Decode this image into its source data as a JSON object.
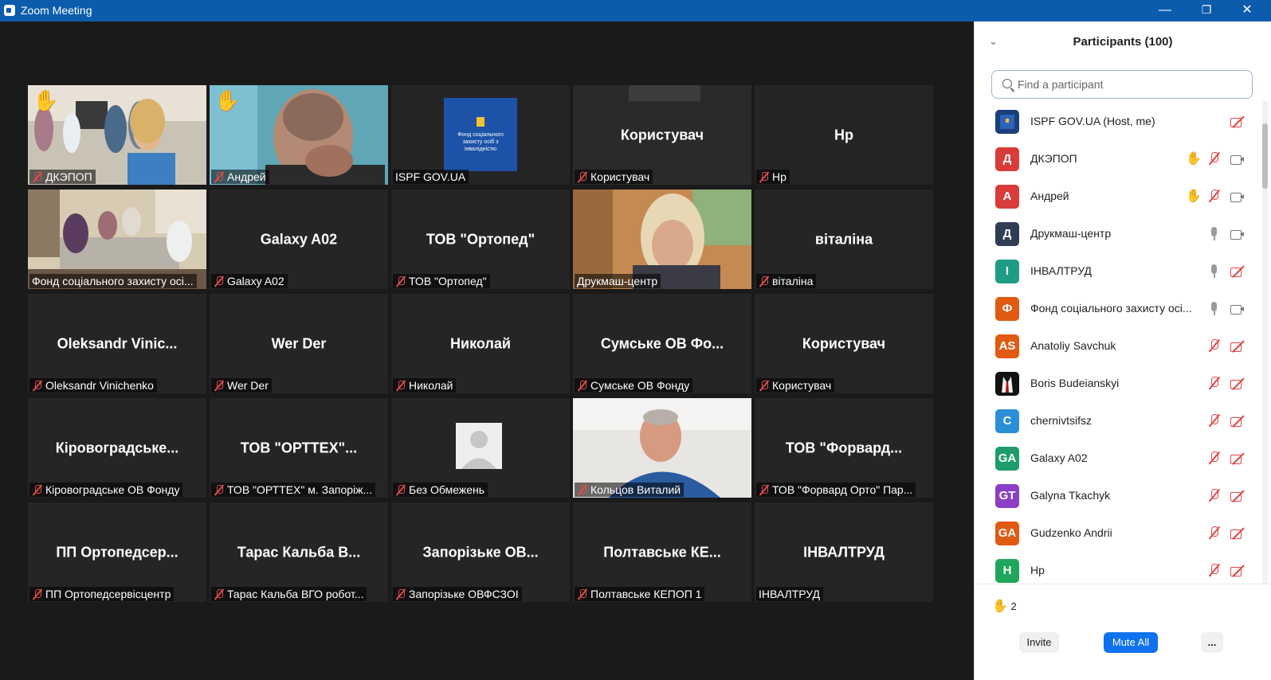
{
  "window": {
    "title": "Zoom Meeting",
    "minimize": "—",
    "restore": "❐",
    "close": "✕"
  },
  "tiles": [
    {
      "label": "ДКЭПОП",
      "center": "",
      "muted": true,
      "hand": true,
      "video": "group-office"
    },
    {
      "label": "Андрей",
      "center": "",
      "muted": true,
      "hand": true,
      "video": "man-closeup"
    },
    {
      "label": "ISPF GOV.UA",
      "center": "",
      "muted": false,
      "hand": false,
      "video": "logo",
      "logo_text": "Фонд соціального захисту осіб з інвалідністю"
    },
    {
      "label": "Користувач",
      "center": "Користувач",
      "muted": true,
      "hand": false,
      "video": "blurred"
    },
    {
      "label": "Нр",
      "center": "Нр",
      "muted": true,
      "hand": false,
      "video": "none"
    },
    {
      "label": "Фонд соціального захисту осі...",
      "center": "",
      "muted": false,
      "hand": false,
      "video": "meeting-room"
    },
    {
      "label": "Galaxy A02",
      "center": "Galaxy A02",
      "muted": true,
      "hand": false,
      "video": "none"
    },
    {
      "label": "ТОВ \"Ортопед\"",
      "center": "ТОВ \"Ортопед\"",
      "muted": true,
      "hand": false,
      "video": "none"
    },
    {
      "label": "Друкмаш-центр",
      "center": "",
      "muted": false,
      "hand": false,
      "video": "woman-office",
      "active": true
    },
    {
      "label": "віталіна",
      "center": "віталіна",
      "muted": true,
      "hand": false,
      "video": "none"
    },
    {
      "label": "Oleksandr Vinichenko",
      "center": "Oleksandr Vinic...",
      "muted": true,
      "hand": false,
      "video": "none"
    },
    {
      "label": "Wer Der",
      "center": "Wer Der",
      "muted": true,
      "hand": false,
      "video": "none"
    },
    {
      "label": "Николай",
      "center": "Николай",
      "muted": true,
      "hand": false,
      "video": "none"
    },
    {
      "label": "Сумське ОВ Фонду",
      "center": "Сумське ОВ Фо...",
      "muted": true,
      "hand": false,
      "video": "none"
    },
    {
      "label": "Користувач",
      "center": "Користувач",
      "muted": true,
      "hand": false,
      "video": "none"
    },
    {
      "label": "Кіровоградське ОВ Фонду",
      "center": "Кіровоградське...",
      "muted": true,
      "hand": false,
      "video": "none"
    },
    {
      "label": "ТОВ \"ОРТТЕХ\" м. Запоріж...",
      "center": "ТОВ \"ОРТТЕХ\"...",
      "muted": true,
      "hand": false,
      "video": "none"
    },
    {
      "label": "Без Обмежень",
      "center": "",
      "muted": true,
      "hand": false,
      "video": "default-avatar"
    },
    {
      "label": "Кольцов Виталий",
      "center": "",
      "muted": true,
      "hand": false,
      "video": "man-office"
    },
    {
      "label": "ТОВ \"Форвард Орто\" Пар...",
      "center": "ТОВ \"Форвард...",
      "muted": true,
      "hand": false,
      "video": "none"
    },
    {
      "label": "ПП Ортопедсервісцентр",
      "center": "ПП Ортопедсер...",
      "muted": true,
      "hand": false,
      "video": "none"
    },
    {
      "label": "Тарас Кальба ВГО робот...",
      "center": "Тарас Кальба В...",
      "muted": true,
      "hand": false,
      "video": "none"
    },
    {
      "label": "Запорізьке ОВФСЗОІ",
      "center": "Запорізьке ОВ...",
      "muted": true,
      "hand": false,
      "video": "none"
    },
    {
      "label": "Полтавське КЕПОП 1",
      "center": "Полтавське КЕ...",
      "muted": true,
      "hand": false,
      "video": "none"
    },
    {
      "label": "ІНВАЛТРУД",
      "center": "ІНВАЛТРУД",
      "muted": false,
      "hand": false,
      "video": "none"
    }
  ],
  "panel": {
    "title": "Participants (100)",
    "collapse": "⌄",
    "search_placeholder": "Find a participant",
    "participants": [
      {
        "name": "ISPF GOV.UA (Host, me)",
        "initials": "",
        "color": "#1a3f7a",
        "hand": false,
        "mic": "none",
        "cam": "off"
      },
      {
        "name": "ДКЭПОП",
        "initials": "Д",
        "color": "#d93b3b",
        "hand": true,
        "mic": "muted",
        "cam": "on"
      },
      {
        "name": "Андрей",
        "initials": "А",
        "color": "#d93b3b",
        "hand": true,
        "mic": "muted",
        "cam": "on"
      },
      {
        "name": "Друкмаш-центр",
        "initials": "Д",
        "color": "#2f3e55",
        "hand": false,
        "mic": "on",
        "cam": "on"
      },
      {
        "name": "ІНВАЛТРУД",
        "initials": "І",
        "color": "#1e9c84",
        "hand": false,
        "mic": "on",
        "cam": "off"
      },
      {
        "name": "Фонд соціального захисту осі...",
        "initials": "Ф",
        "color": "#e05a12",
        "hand": false,
        "mic": "on",
        "cam": "on"
      },
      {
        "name": "Anatoliy Savchuk",
        "initials": "AS",
        "color": "#e05a12",
        "hand": false,
        "mic": "muted",
        "cam": "off"
      },
      {
        "name": "Boris Budeianskyi",
        "initials": "",
        "color": "#111111",
        "hand": false,
        "mic": "muted",
        "cam": "off"
      },
      {
        "name": "chernivtsifsz",
        "initials": "C",
        "color": "#2a8fd6",
        "hand": false,
        "mic": "muted",
        "cam": "off"
      },
      {
        "name": "Galaxy A02",
        "initials": "GA",
        "color": "#1e9c6b",
        "hand": false,
        "mic": "muted",
        "cam": "off"
      },
      {
        "name": "Galyna Tkachyk",
        "initials": "GT",
        "color": "#8a3fc4",
        "hand": false,
        "mic": "muted",
        "cam": "off"
      },
      {
        "name": "Gudzenko Andrii",
        "initials": "GA",
        "color": "#e05a12",
        "hand": false,
        "mic": "muted",
        "cam": "off"
      },
      {
        "name": "Нр",
        "initials": "Н",
        "color": "#1fa65a",
        "hand": false,
        "mic": "muted",
        "cam": "off"
      }
    ],
    "hand_count": "2",
    "hand_icon": "✋",
    "invite": "Invite",
    "mute_all": "Mute All",
    "more": "..."
  }
}
